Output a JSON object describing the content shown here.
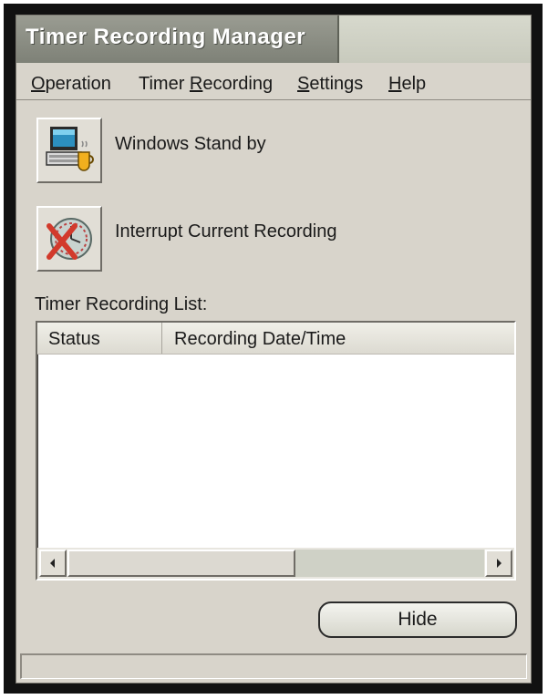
{
  "window": {
    "title": "Timer Recording Manager"
  },
  "menu": {
    "items": [
      {
        "label": "Operation",
        "mnemonic": "O"
      },
      {
        "label": "Timer Recording",
        "mnemonic": "R"
      },
      {
        "label": "Settings",
        "mnemonic": "S"
      },
      {
        "label": "Help",
        "mnemonic": "H"
      }
    ]
  },
  "actions": {
    "standby_label": "Windows Stand by",
    "interrupt_label": "Interrupt Current Recording"
  },
  "list": {
    "label": "Timer Recording List:",
    "columns": [
      "Status",
      "Recording Date/Time"
    ],
    "rows": []
  },
  "buttons": {
    "hide_label": "Hide"
  },
  "statusbar": {
    "text": ""
  }
}
